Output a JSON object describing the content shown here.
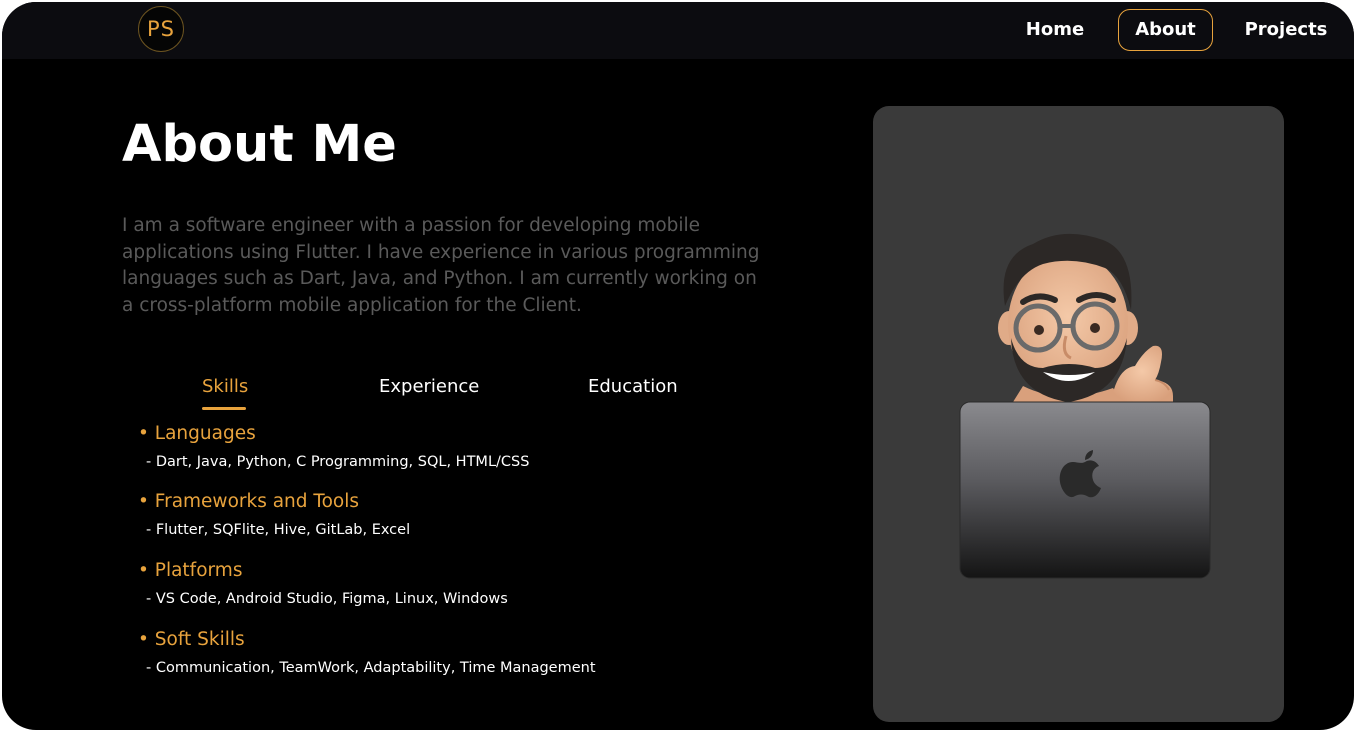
{
  "nav": {
    "logo": "PS",
    "links": [
      "Home",
      "About",
      "Projects"
    ],
    "active": "About"
  },
  "about": {
    "title": "About Me",
    "description": "I am a software engineer with a passion for developing mobile applications using Flutter. I have experience in various programming languages such as Dart, Java, and Python. I am currently working on a cross-platform mobile application for the Client."
  },
  "tabs": {
    "items": [
      "Skills",
      "Experience",
      "Education"
    ],
    "active": "Skills"
  },
  "skills": [
    {
      "heading": "• Languages",
      "items": "- Dart, Java, Python, C Programming, SQL, HTML/CSS"
    },
    {
      "heading": "• Frameworks and Tools",
      "items": "- Flutter, SQFlite, Hive, GitLab, Excel"
    },
    {
      "heading": "• Platforms",
      "items": "- VS Code, Android Studio, Figma, Linux, Windows"
    },
    {
      "heading": "• Soft Skills",
      "items": "- Communication, TeamWork, Adaptability, Time Management"
    }
  ],
  "colors": {
    "accent": "#e8a33d",
    "background": "#000000",
    "navbar": "#0c0c10",
    "card": "#3a3a3a",
    "muted_text": "#5a5a5a"
  },
  "icons": {
    "logo": "ps-monogram-logo",
    "avatar": "memoji-avatar-with-laptop",
    "laptop_logo": "apple-icon"
  }
}
